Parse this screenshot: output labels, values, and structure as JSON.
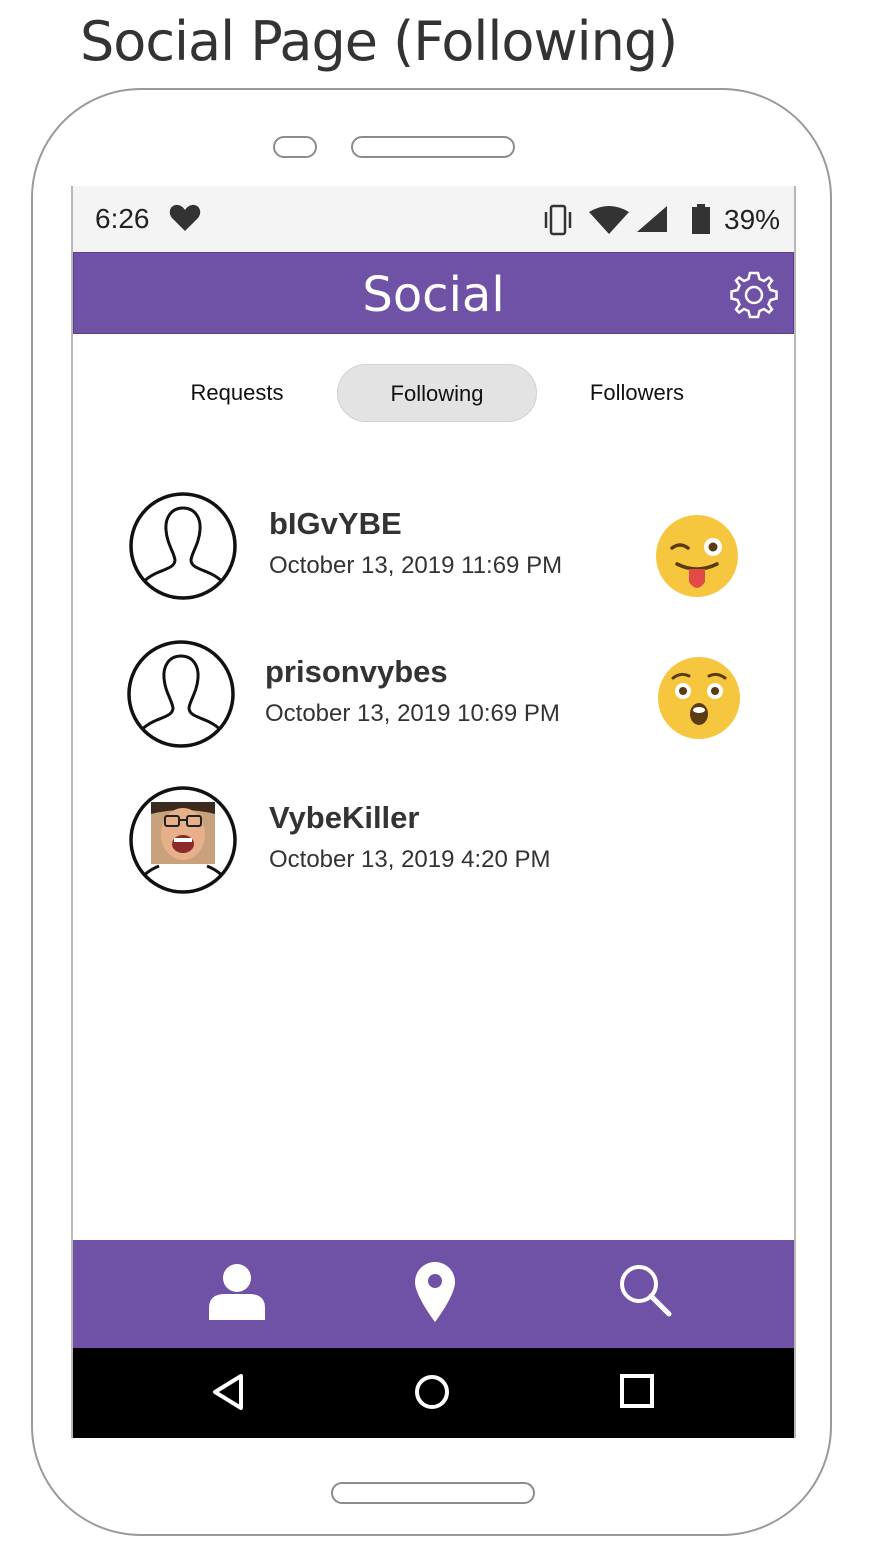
{
  "page_title": "Social Page (Following)",
  "status_bar": {
    "time": "6:26",
    "battery_percent": "39%",
    "icons": [
      "heart-icon",
      "vibrate-icon",
      "wifi-icon",
      "signal-icon",
      "battery-icon"
    ]
  },
  "app_bar": {
    "title": "Social",
    "settings_icon": "gear-icon"
  },
  "tabs": [
    {
      "label": "Requests",
      "active": false
    },
    {
      "label": "Following",
      "active": true
    },
    {
      "label": "Followers",
      "active": false
    }
  ],
  "following": [
    {
      "username": "bIGvYBE",
      "date": "October 13, 2019  11:69 PM",
      "avatar": "default-avatar-icon",
      "reaction": "winking-tongue-emoji"
    },
    {
      "username": "prisonvybes",
      "date": "October 13, 2019  10:69 PM",
      "avatar": "default-avatar-icon",
      "reaction": "surprised-emoji"
    },
    {
      "username": "VybeKiller",
      "date": "October 13, 2019  4:20 PM",
      "avatar": "photo-avatar",
      "reaction": ""
    }
  ],
  "bottom_nav": {
    "items": [
      "profile-icon",
      "location-pin-icon",
      "search-icon"
    ]
  },
  "system_nav": {
    "items": [
      "back-icon",
      "home-icon",
      "recents-icon"
    ]
  },
  "colors": {
    "accent": "#6f52a6",
    "status_bar_bg": "#f4f4f4",
    "active_tab_bg": "#e3e3e3",
    "emoji_yellow": "#f6c73e"
  }
}
